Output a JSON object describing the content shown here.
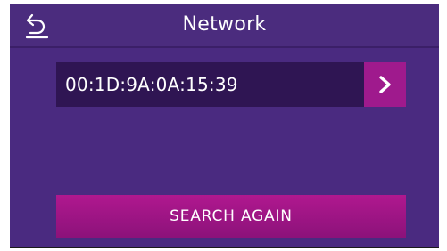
{
  "header": {
    "title": "Network",
    "back_icon": "back-arrow-icon"
  },
  "devices": [
    {
      "mac": "00:1D:9A:0A:15:39",
      "arrow_icon": "chevron-right-icon"
    }
  ],
  "actions": {
    "search_again_label": "SEARCH AGAIN"
  },
  "colors": {
    "background": "#4a2a80",
    "row_background": "#2f1553",
    "accent": "#9f1a8d",
    "text": "#ffffff"
  }
}
